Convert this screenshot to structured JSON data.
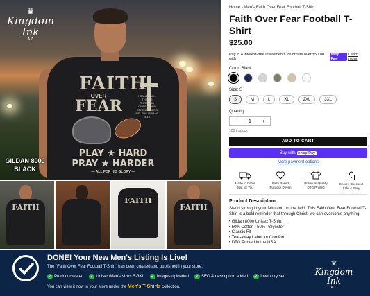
{
  "hero": {
    "logo": {
      "name": "Kingdom Ink",
      "sub": "AZ"
    },
    "tag_line1": "GILDAN 8000",
    "tag_line2": "BLACK",
    "print": {
      "faith": "FAITH",
      "over": "OVER",
      "fear": "FEAR",
      "play": "PLAY ★ HARD",
      "pray": "PRAY ★ HARDER",
      "glory": "— ALL FOR HIS GLORY —",
      "verse": "I CAN DO ALL THINGS THROUGH CHRIST WHO STRENGTHENS ME. PHILIPPIANS 4:13"
    }
  },
  "product": {
    "breadcrumb": {
      "home": "Home",
      "sep": "›",
      "current": "Men's Faith Over Fear Football T-Shirt"
    },
    "title": "Faith Over Fear Football T-Shirt",
    "price": "$25.00",
    "installments_text": "Pay in 4 interest-free installments for orders over $50.00 with",
    "shoppay_label": "shop Pay",
    "learn_more": "Learn more",
    "color_label": "Color: Black",
    "colors": [
      "#000000",
      "#1f2a4d",
      "#d4d4d4",
      "#7a8068",
      "#d3c2a6",
      "#ffffff"
    ],
    "size_label": "Size: S",
    "sizes": [
      "S",
      "M",
      "L",
      "XL",
      "2XL",
      "3XL"
    ],
    "quantity_label": "Quantity",
    "qty_minus": "−",
    "qty_value": "1",
    "qty_plus": "+",
    "stock": "100 in stock",
    "add_to_cart": "ADD TO CART",
    "buy_with": "Buy with",
    "buy_shoppay": "shop Pay",
    "more_payment": "More payment options",
    "features": [
      {
        "icon": "truck-icon",
        "line1": "Made to Order",
        "line2": "Just for You"
      },
      {
        "icon": "heart-icon",
        "line1": "Faith Based",
        "line2": "Purpose Driven"
      },
      {
        "icon": "shirt-icon",
        "line1": "Premium Quality",
        "line2": "DTG Printed"
      },
      {
        "icon": "lock-icon",
        "line1": "Secure Checkout",
        "line2": "Safe & Easy"
      }
    ],
    "description_heading": "Product Description",
    "description": "Stand strong in your faith and on the field. This Faith Over Fear Football T-Shirt is a bold reminder that through Christ, we can overcome anything.",
    "bullets": [
      "Gildan 8000 Unisex T-Shirt",
      "50% Cotton / 50% Polyester",
      "Classic Fit",
      "Tear-away Label for Comfort",
      "DTG Printed in the USA"
    ]
  },
  "banner": {
    "title": "DONE! Your New Men's Listing Is Live!",
    "subtitle": "The \"Faith Over Fear Football T-Shirt\" has been created and published in your store.",
    "items": [
      "Product created",
      "Unisex/Men's sizes S-3XL",
      "Images uploaded",
      "SEO & description added",
      "Inventory set"
    ],
    "foot_before": "You can view it now in your store under the",
    "foot_highlight": "Men's T-Shirts",
    "foot_after": "collection.",
    "logo": {
      "name": "Kingdom Ink",
      "sub": "AZ"
    }
  },
  "colors": {
    "banner_bg": "#0c2445",
    "shoppay": "#5a31f4",
    "accent_gold": "#f2b640",
    "check_green": "#2fb34a"
  }
}
